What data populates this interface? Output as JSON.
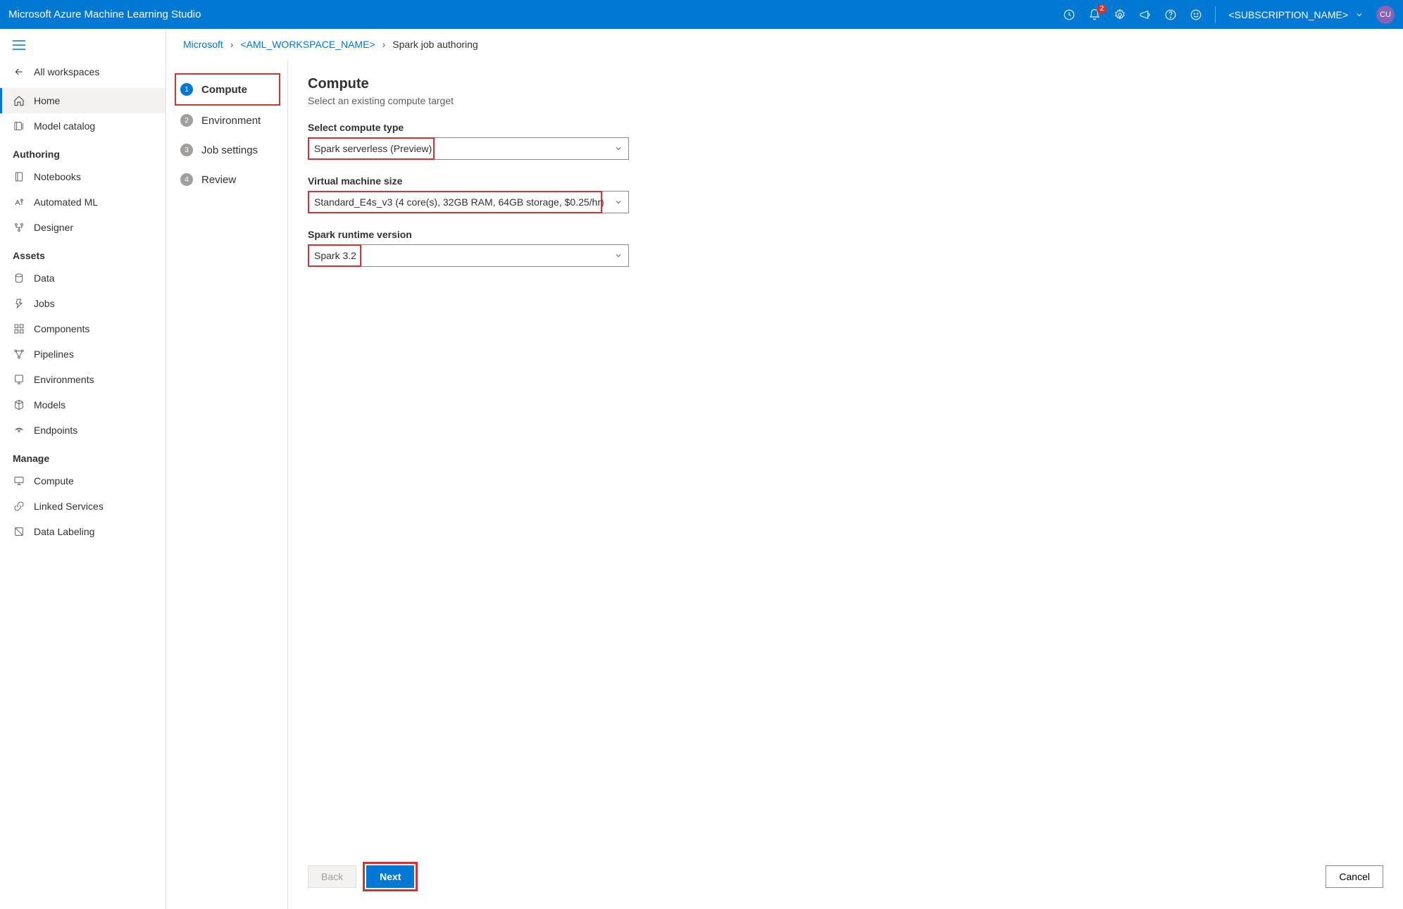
{
  "header": {
    "title": "Microsoft Azure Machine Learning Studio",
    "notification_count": "2",
    "subscription": "<SUBSCRIPTION_NAME>",
    "avatar_initials": "CU"
  },
  "sidebar": {
    "back_label": "All workspaces",
    "top_items": [
      {
        "label": "Home"
      },
      {
        "label": "Model catalog"
      }
    ],
    "sections": [
      {
        "label": "Authoring",
        "items": [
          {
            "label": "Notebooks"
          },
          {
            "label": "Automated ML"
          },
          {
            "label": "Designer"
          }
        ]
      },
      {
        "label": "Assets",
        "items": [
          {
            "label": "Data"
          },
          {
            "label": "Jobs"
          },
          {
            "label": "Components"
          },
          {
            "label": "Pipelines"
          },
          {
            "label": "Environments"
          },
          {
            "label": "Models"
          },
          {
            "label": "Endpoints"
          }
        ]
      },
      {
        "label": "Manage",
        "items": [
          {
            "label": "Compute"
          },
          {
            "label": "Linked Services"
          },
          {
            "label": "Data Labeling"
          }
        ]
      }
    ]
  },
  "breadcrumbs": {
    "root": "Microsoft",
    "workspace": "<AML_WORKSPACE_NAME>",
    "current": "Spark job authoring"
  },
  "wizard": {
    "steps": [
      {
        "num": "1",
        "label": "Compute"
      },
      {
        "num": "2",
        "label": "Environment"
      },
      {
        "num": "3",
        "label": "Job settings"
      },
      {
        "num": "4",
        "label": "Review"
      }
    ]
  },
  "form": {
    "title": "Compute",
    "subtitle": "Select an existing compute target",
    "compute_type_label": "Select compute type",
    "compute_type_value": "Spark serverless (Preview)",
    "vm_size_label": "Virtual machine size",
    "vm_size_value": "Standard_E4s_v3 (4 core(s), 32GB RAM, 64GB storage, $0.25/hr)",
    "runtime_label": "Spark runtime version",
    "runtime_value": "Spark 3.2"
  },
  "footer": {
    "back": "Back",
    "next": "Next",
    "cancel": "Cancel"
  }
}
